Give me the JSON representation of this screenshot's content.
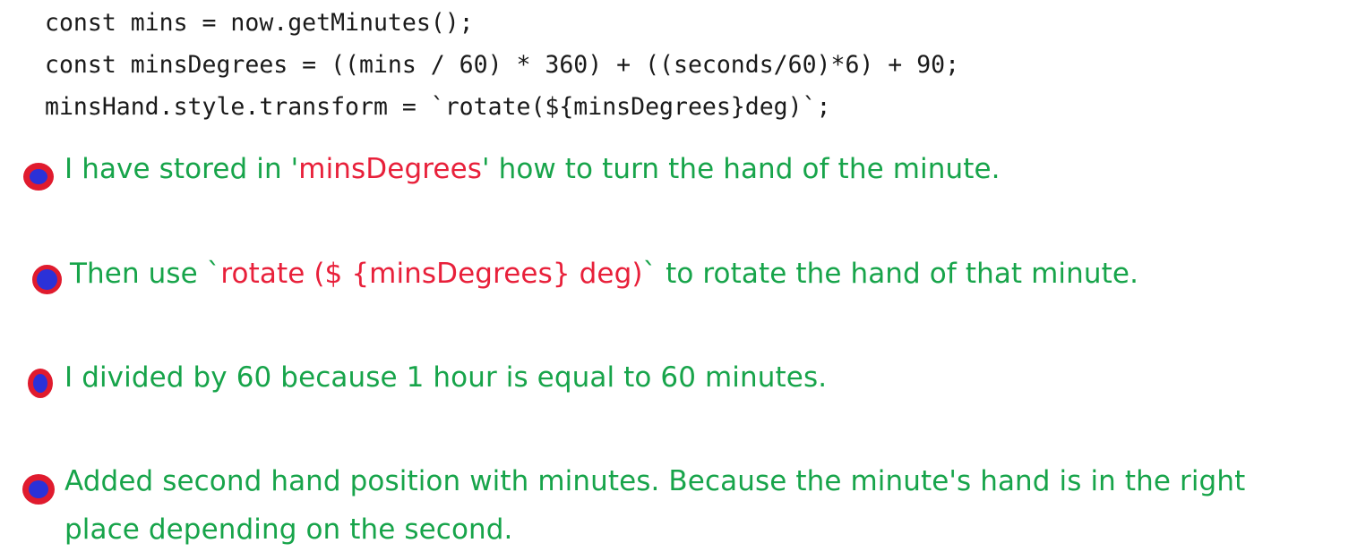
{
  "colors": {
    "background": "#ffffff",
    "code_text": "#1a1a1a",
    "note_text_green": "#17a44a",
    "inline_code_red": "#e8203a",
    "bullet_ring_red": "#e01b2e",
    "bullet_core_blue": "#2b31d8"
  },
  "code_block": {
    "lines": [
      "const mins = now.getMinutes();",
      "const minsDegrees = ((mins / 60) * 360) + ((seconds/60)*6) + 90;",
      "minsHand.style.transform = `rotate(${minsDegrees}deg)`;"
    ]
  },
  "notes": {
    "bullets": [
      {
        "marker": "blue-red-bullet-icon",
        "segments": [
          {
            "text": "I have stored in '",
            "style": "green"
          },
          {
            "text": "minsDegrees",
            "style": "red"
          },
          {
            "text": "' how to turn the hand of the minute.",
            "style": "green"
          }
        ]
      },
      {
        "marker": "blue-red-bullet-icon",
        "segments": [
          {
            "text": "Then use `",
            "style": "green"
          },
          {
            "text": "rotate ($ {minsDegrees} deg)",
            "style": "red"
          },
          {
            "text": "` to rotate the hand of that minute.",
            "style": "green"
          }
        ]
      },
      {
        "marker": "blue-red-bullet-icon",
        "segments": [
          {
            "text": "I divided by 60 because 1 hour is equal to 60 minutes.",
            "style": "green"
          }
        ]
      },
      {
        "marker": "blue-red-bullet-icon",
        "segments": [
          {
            "text": "Added second hand position with minutes. Because the minute's hand is in the right place depending on the second.",
            "style": "green"
          }
        ]
      }
    ]
  }
}
